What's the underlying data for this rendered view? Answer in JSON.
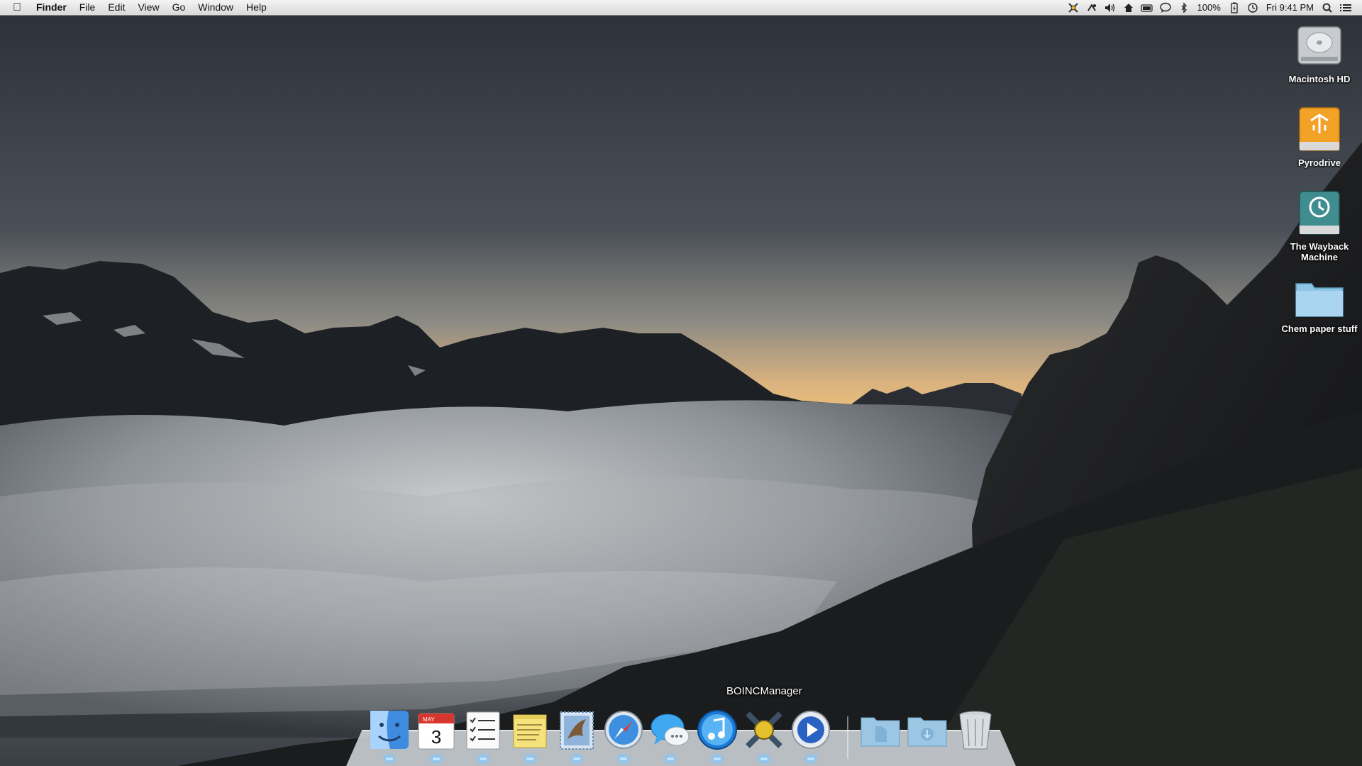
{
  "menubar": {
    "app_name": "Finder",
    "menus": [
      "File",
      "Edit",
      "View",
      "Go",
      "Window",
      "Help"
    ],
    "status_icons": [
      "boinc-icon",
      "cloud-sync-icon",
      "volume-icon",
      "home-icon",
      "battery-meter-icon",
      "messages-icon",
      "bluetooth-icon"
    ],
    "battery_percent": "100%",
    "clock": "Fri 9:41 PM"
  },
  "desktop_icons": [
    {
      "label": "Macintosh HD",
      "icon": "hard-drive-icon"
    },
    {
      "label": "Pyrodrive",
      "icon": "firewire-drive-icon"
    },
    {
      "label": "The Wayback Machine",
      "icon": "time-machine-drive-icon"
    },
    {
      "label": "Chem paper stuff",
      "icon": "folder-icon"
    }
  ],
  "dock": {
    "hover_label": "BOINCManager",
    "calendar": {
      "month": "MAY",
      "day": "3"
    },
    "items": [
      "finder",
      "ical",
      "reminders",
      "stickies",
      "mail",
      "safari",
      "messages",
      "itunes",
      "boincmanager",
      "quicktime",
      "documents-stack",
      "downloads-stack",
      "trash"
    ]
  },
  "colors": {
    "sky_top": "#2c3138",
    "sky_horizon": "#f2c07a",
    "clouds": "#9aa0a6",
    "mountains": "#15181b",
    "menubar": "#e6e6e6"
  }
}
